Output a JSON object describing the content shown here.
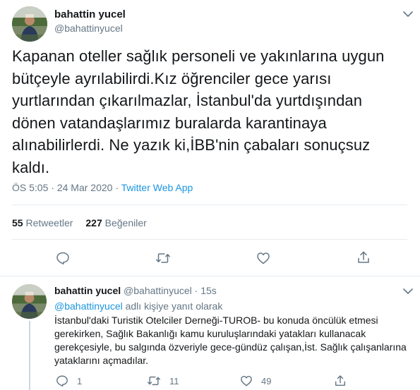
{
  "tweet": {
    "author_name": "bahattin yucel",
    "author_handle": "@bahattinyucel",
    "text": "Kapanan oteller sağlık personeli ve yakınlarına uygun bütçeyle ayrılabilirdi.Kız öğrenciler gece yarısı yurtlarından çıkarılmazlar, İstanbul'da yurtdışından dönen vatandaşlarımız buralarda  karantinaya alınabilirlerdi. Ne yazık ki,İBB'nin çabaları sonuçsuz kaldı.",
    "time": "ÖS 5:05",
    "separator": " · ",
    "date": "24 Mar 2020",
    "source": "Twitter Web App",
    "retweet_count": "55",
    "retweet_label": "Retweetler",
    "like_count": "227",
    "like_label": "Beğeniler"
  },
  "reply": {
    "author_name": "bahattin yucel",
    "author_handle": "@bahattinyucel",
    "time_ago": "15s",
    "separator": " · ",
    "mention": "@bahattinyucel",
    "reply_suffix": " adlı kişiye yanıt olarak",
    "text": "İstanbul'daki Turistik Otelciler Derneği-TUROB- bu konuda öncülük etmesi gerekirken, Sağlık Bakanlığı kamu kuruluşlarındaki yatakları kullanacak gerekçesiyle, bu salgında özveriyle gece-gündüz çalışan,İst. Sağlık çalışanlarına yataklarını açmadılar.",
    "reply_count": "1",
    "retweet_count": "11",
    "like_count": "49"
  },
  "icons": {
    "reply": "reply-icon",
    "retweet": "retweet-icon",
    "like": "heart-icon",
    "share": "share-icon",
    "caret": "chevron-down-icon"
  },
  "colors": {
    "accent": "#1b95e0",
    "secondary_text": "#657786",
    "border": "#e6ecf0"
  }
}
